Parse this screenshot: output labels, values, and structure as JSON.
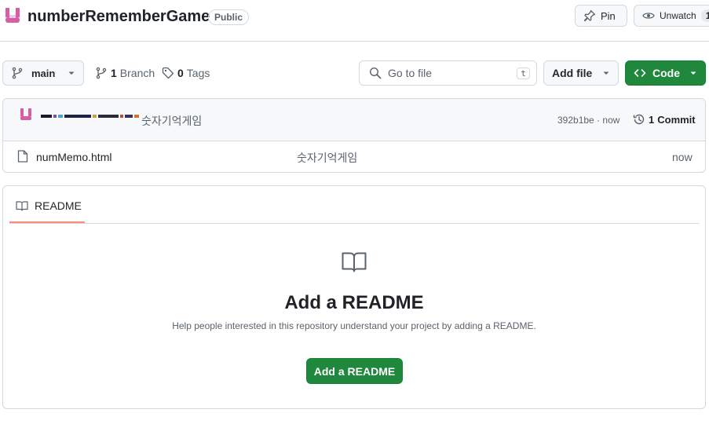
{
  "repo": {
    "name": "numberRememberGame",
    "visibility": "Public",
    "pin_label": "Pin",
    "watch_label": "Unwatch",
    "watch_count": "1"
  },
  "toolbar": {
    "branch": "main",
    "branches_count": "1",
    "branches_label": "Branch",
    "tags_count": "0",
    "tags_label": "Tags",
    "search_placeholder": "Go to file",
    "search_shortcut": "t",
    "add_file_label": "Add file",
    "code_label": "Code"
  },
  "latest_commit": {
    "message": "숫자기억게임",
    "hash": "392b1be",
    "time": "now",
    "commits_count": "1",
    "commits_label": "Commit"
  },
  "files": [
    {
      "name": "numMemo.html",
      "message": "숫자기억게임",
      "time": "now"
    }
  ],
  "readme": {
    "tab_label": "README",
    "title": "Add a README",
    "description": "Help people interested in this repository understand your project by adding a README.",
    "button_label": "Add a README"
  },
  "colors": {
    "primary_green": "#1f883d",
    "border": "#d1d9e0",
    "muted_text": "#59636e",
    "tab_underline": "#fd8c73",
    "avatar": "#d45fa5"
  }
}
